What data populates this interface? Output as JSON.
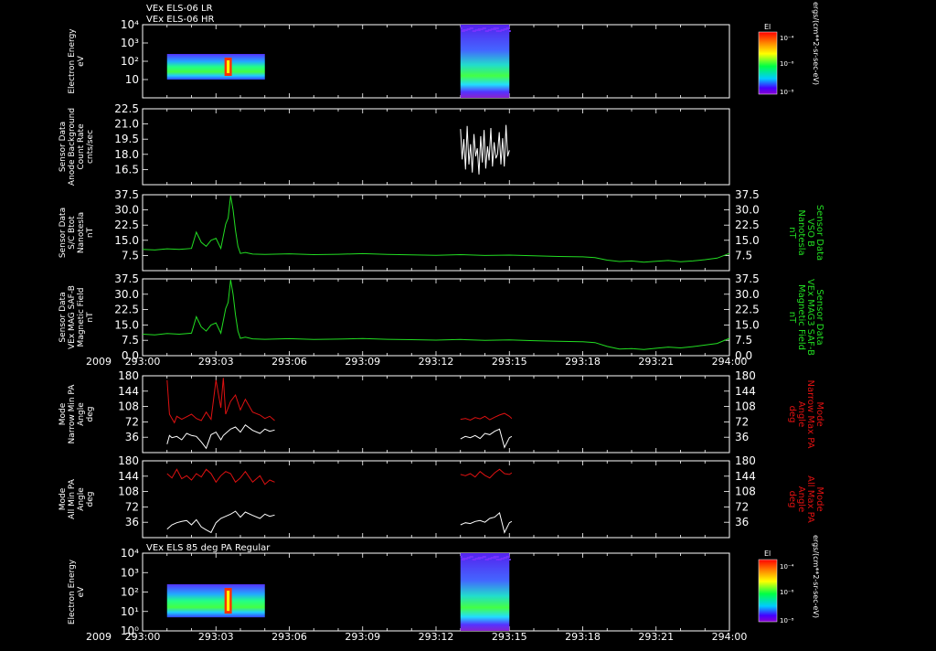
{
  "header": {
    "line1": "VEx ELS-06 LR",
    "line2": "VEx ELS-06 HR",
    "panel7_title": "VEx ELS 85 deg PA Regular"
  },
  "x_axis": {
    "year_label": "2009",
    "ticks": [
      "293:00",
      "293:03",
      "293:06",
      "293:09",
      "293:12",
      "293:15",
      "293:18",
      "293:21",
      "294:00"
    ]
  },
  "colors": {
    "background": "#000000",
    "axis": "#ffffff",
    "green": "#22dd22",
    "red": "#dd1111",
    "white": "#ffffff"
  },
  "colorbar": {
    "label": "El",
    "unit": "ergs/(cm**2-sr-sec-eV)",
    "ticks": [
      "10⁻⁴",
      "10⁻⁶",
      "10⁻⁸"
    ]
  },
  "chart_data": [
    {
      "type": "heatmap",
      "id": "els_lr_hr",
      "ylabel_lines": [
        "Electron Energy",
        "eV"
      ],
      "y_scale": "log",
      "ylim": [
        1,
        10000
      ],
      "yticks": [
        "10⁴",
        "10³",
        "10²",
        "10"
      ],
      "segments": [
        {
          "x_start": "293:01",
          "x_end": "293:05",
          "e_low": 10,
          "e_high": 250
        },
        {
          "x_start": "293:13",
          "x_end": "293:15",
          "e_low": 1,
          "e_high": 10000
        }
      ]
    },
    {
      "type": "line",
      "id": "anode_background",
      "ylabel_lines": [
        "Sensor Data",
        "Anode Background",
        "Count Rate",
        "cnts/sec"
      ],
      "ylim": [
        15.0,
        22.5
      ],
      "yticks": [
        "22.5",
        "21.0",
        "19.5",
        "18.0",
        "16.5"
      ],
      "series": [
        {
          "color": "#ffffff",
          "x_start": "293:13",
          "x_end": "293:15",
          "values": [
            20.5,
            17.5,
            19.5,
            16.5,
            20.8,
            17.0,
            19.0,
            16.2,
            20.0,
            17.8,
            18.6,
            16.0,
            19.8,
            17.2,
            20.4,
            16.6,
            18.8,
            17.4,
            20.6,
            16.8,
            19.2,
            17.6,
            18.0,
            20.2,
            17.0,
            19.6,
            16.8,
            20.9,
            17.8,
            18.4
          ]
        }
      ]
    },
    {
      "type": "line",
      "id": "bmag_sc",
      "ylabel_lines": [
        "Sensor Data",
        "S/C Btot",
        "Nanotesla",
        "nT"
      ],
      "ylabel_right_lines": [
        "Sensor Data",
        "VSO B",
        "Nanotesla",
        "nT"
      ],
      "ylim": [
        0,
        37.5
      ],
      "yticks": [
        "37.5",
        "30.0",
        "22.5",
        "15.0",
        "7.5"
      ],
      "series": [
        {
          "color": "#22dd22",
          "x": [
            0,
            0.5,
            1,
            1.5,
            2,
            2.2,
            2.4,
            2.6,
            2.8,
            3.0,
            3.2,
            3.4,
            3.5,
            3.6,
            3.7,
            3.8,
            3.9,
            4.0,
            4.2,
            4.5,
            5,
            6,
            7,
            8,
            9,
            10,
            11,
            12,
            13,
            14,
            15,
            16,
            17,
            18,
            18.5,
            19,
            19.5,
            20,
            20.5,
            21,
            21.5,
            22,
            22.5,
            23,
            23.5,
            24
          ],
          "values": [
            10.5,
            10.2,
            10.8,
            10.5,
            11,
            19,
            14,
            12,
            15,
            16,
            11,
            23,
            26,
            37,
            30,
            20,
            12,
            8.5,
            9,
            8.2,
            8,
            8.3,
            7.9,
            8.1,
            8.4,
            8.0,
            7.8,
            7.6,
            7.9,
            7.5,
            7.7,
            7.3,
            7.0,
            6.8,
            6.4,
            5.2,
            4.5,
            4.8,
            4.2,
            4.6,
            5.0,
            4.4,
            4.8,
            5.4,
            6.2,
            8.5
          ]
        }
      ]
    },
    {
      "type": "line",
      "id": "bmag_mag",
      "ylabel_lines": [
        "Sensor Data",
        "VEx MAG SAF-B",
        "Magnetic Field",
        "nT"
      ],
      "ylabel_right_lines": [
        "Sensor Data",
        "VEx MAG3 SAF-B",
        "Magnetic Field",
        "nT"
      ],
      "ylim": [
        0,
        37.5
      ],
      "yticks": [
        "37.5",
        "30.0",
        "22.5",
        "15.0",
        "7.5",
        "0.0"
      ],
      "series": [
        {
          "color": "#22dd22",
          "x": [
            0,
            0.5,
            1,
            1.5,
            2,
            2.2,
            2.4,
            2.6,
            2.8,
            3.0,
            3.2,
            3.4,
            3.5,
            3.6,
            3.7,
            3.8,
            3.9,
            4.0,
            4.2,
            4.5,
            5,
            6,
            7,
            8,
            9,
            10,
            11,
            12,
            13,
            14,
            15,
            16,
            17,
            18,
            18.5,
            19,
            19.5,
            20,
            20.5,
            21,
            21.5,
            22,
            22.5,
            23,
            23.5,
            24
          ],
          "values": [
            10.5,
            10.2,
            10.8,
            10.5,
            11,
            19,
            14,
            12,
            15,
            16,
            11,
            23,
            26,
            37,
            30,
            20,
            12,
            8.5,
            9,
            8.2,
            8,
            8.3,
            7.9,
            8.1,
            8.4,
            8.0,
            7.8,
            7.6,
            7.9,
            7.5,
            7.7,
            7.3,
            7.0,
            6.8,
            6.4,
            4.5,
            3.2,
            3.5,
            3.0,
            3.6,
            4.2,
            3.8,
            4.4,
            5.2,
            6.0,
            8.5
          ]
        }
      ]
    },
    {
      "type": "line",
      "id": "narrow_pa",
      "ylabel_lines": [
        "Mode",
        "Narrow Min PA",
        "Angle",
        "deg"
      ],
      "ylabel_right_lines": [
        "Mode",
        "Narrow Max PA",
        "Angle",
        "deg"
      ],
      "ylim": [
        0,
        180
      ],
      "yticks": [
        "180",
        "144",
        "108",
        "72",
        "36"
      ],
      "series": [
        {
          "color": "#dd1111",
          "x": [
            1,
            1.1,
            1.2,
            1.3,
            1.4,
            1.6,
            1.8,
            2.0,
            2.2,
            2.4,
            2.6,
            2.8,
            3.0,
            3.2,
            3.3,
            3.4,
            3.6,
            3.8,
            4.0,
            4.2,
            4.5,
            4.8,
            5.0,
            5.2,
            5.4
          ],
          "values": [
            170,
            90,
            80,
            70,
            85,
            78,
            84,
            90,
            80,
            75,
            95,
            78,
            170,
            105,
            175,
            90,
            120,
            135,
            100,
            125,
            95,
            88,
            80,
            85,
            75
          ]
        },
        {
          "color": "#dd1111",
          "x": [
            13,
            13.2,
            13.4,
            13.6,
            13.8,
            14,
            14.2,
            14.4,
            14.6,
            14.8,
            15,
            15.1
          ],
          "values": [
            78,
            80,
            76,
            82,
            79,
            85,
            77,
            83,
            88,
            92,
            85,
            80
          ]
        },
        {
          "color": "#ffffff",
          "x": [
            1,
            1.1,
            1.2,
            1.4,
            1.6,
            1.8,
            2.0,
            2.2,
            2.4,
            2.6,
            2.8,
            3.0,
            3.2,
            3.3,
            3.4,
            3.6,
            3.8,
            4.0,
            4.2,
            4.5,
            4.8,
            5.0,
            5.2,
            5.4
          ],
          "values": [
            20,
            40,
            35,
            38,
            30,
            45,
            40,
            38,
            25,
            10,
            42,
            48,
            30,
            40,
            45,
            55,
            60,
            48,
            65,
            52,
            45,
            55,
            50,
            53
          ]
        },
        {
          "color": "#ffffff",
          "x": [
            13,
            13.2,
            13.4,
            13.6,
            13.8,
            14,
            14.2,
            14.4,
            14.6,
            14.8,
            15,
            15.1
          ],
          "values": [
            32,
            38,
            35,
            40,
            33,
            45,
            42,
            50,
            55,
            12,
            35,
            38
          ]
        }
      ]
    },
    {
      "type": "line",
      "id": "all_pa",
      "ylabel_lines": [
        "Mode",
        "All Min PA",
        "Angle",
        "deg"
      ],
      "ylabel_right_lines": [
        "Mode",
        "All Max PA",
        "Angle",
        "deg"
      ],
      "ylim": [
        0,
        180
      ],
      "yticks": [
        "180",
        "144",
        "108",
        "72",
        "36"
      ],
      "series": [
        {
          "color": "#dd1111",
          "x": [
            1,
            1.2,
            1.4,
            1.6,
            1.8,
            2.0,
            2.2,
            2.4,
            2.6,
            2.8,
            3.0,
            3.2,
            3.4,
            3.6,
            3.8,
            4.0,
            4.2,
            4.5,
            4.8,
            5.0,
            5.2,
            5.4
          ],
          "values": [
            150,
            140,
            160,
            138,
            145,
            135,
            150,
            142,
            160,
            150,
            130,
            145,
            155,
            150,
            130,
            140,
            155,
            130,
            145,
            125,
            135,
            130
          ]
        },
        {
          "color": "#dd1111",
          "x": [
            13,
            13.2,
            13.4,
            13.6,
            13.8,
            14,
            14.2,
            14.4,
            14.6,
            14.8,
            15,
            15.1
          ],
          "values": [
            148,
            145,
            150,
            142,
            155,
            146,
            140,
            152,
            160,
            150,
            148,
            152
          ]
        },
        {
          "color": "#ffffff",
          "x": [
            1,
            1.2,
            1.4,
            1.6,
            1.8,
            2.0,
            2.2,
            2.4,
            2.6,
            2.8,
            3.0,
            3.2,
            3.4,
            3.6,
            3.8,
            4.0,
            4.2,
            4.5,
            4.8,
            5.0,
            5.2,
            5.4
          ],
          "values": [
            20,
            30,
            35,
            38,
            40,
            30,
            42,
            25,
            18,
            12,
            35,
            45,
            50,
            55,
            62,
            48,
            60,
            52,
            45,
            55,
            50,
            53
          ]
        },
        {
          "color": "#ffffff",
          "x": [
            13,
            13.2,
            13.4,
            13.6,
            13.8,
            14,
            14.2,
            14.4,
            14.6,
            14.8,
            15,
            15.1
          ],
          "values": [
            30,
            35,
            33,
            38,
            40,
            36,
            45,
            48,
            58,
            12,
            35,
            38
          ]
        }
      ]
    },
    {
      "type": "heatmap",
      "id": "els_85pa",
      "ylabel_lines": [
        "Electron Energy",
        "eV"
      ],
      "y_scale": "log",
      "ylim": [
        1,
        10000
      ],
      "yticks": [
        "10⁴",
        "10³",
        "10²",
        "10¹",
        "10⁰"
      ],
      "segments": [
        {
          "x_start": "293:01",
          "x_end": "293:05",
          "e_low": 5,
          "e_high": 250
        },
        {
          "x_start": "293:13",
          "x_end": "293:15",
          "e_low": 1,
          "e_high": 10000
        }
      ]
    }
  ]
}
